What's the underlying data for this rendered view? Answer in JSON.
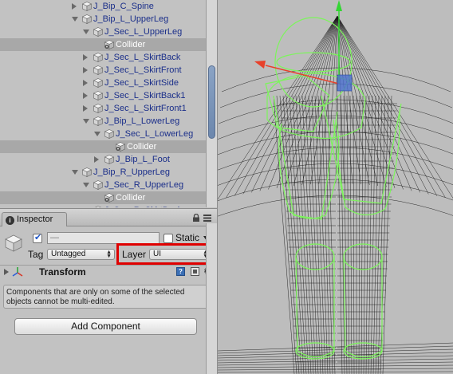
{
  "hierarchy": {
    "items": [
      {
        "label": "J_Bip_C_Spine",
        "depth": 0,
        "expanded": false,
        "kind": "cube",
        "selected": false
      },
      {
        "label": "J_Bip_L_UpperLeg",
        "depth": 0,
        "expanded": true,
        "kind": "cube",
        "selected": false
      },
      {
        "label": "J_Sec_L_UpperLeg",
        "depth": 1,
        "expanded": true,
        "kind": "cube",
        "selected": false
      },
      {
        "label": "Collider",
        "depth": 2,
        "expanded": null,
        "kind": "collider",
        "selected": true
      },
      {
        "label": "J_Sec_L_SkirtBack",
        "depth": 1,
        "expanded": false,
        "kind": "cube",
        "selected": false
      },
      {
        "label": "J_Sec_L_SkirtFront",
        "depth": 1,
        "expanded": false,
        "kind": "cube",
        "selected": false
      },
      {
        "label": "J_Sec_L_SkirtSide",
        "depth": 1,
        "expanded": false,
        "kind": "cube",
        "selected": false
      },
      {
        "label": "J_Sec_L_SkirtBack1",
        "depth": 1,
        "expanded": false,
        "kind": "cube",
        "selected": false
      },
      {
        "label": "J_Sec_L_SkirtFront1",
        "depth": 1,
        "expanded": false,
        "kind": "cube",
        "selected": false
      },
      {
        "label": "J_Bip_L_LowerLeg",
        "depth": 1,
        "expanded": true,
        "kind": "cube",
        "selected": false
      },
      {
        "label": "J_Sec_L_LowerLeg",
        "depth": 2,
        "expanded": true,
        "kind": "cube",
        "selected": false
      },
      {
        "label": "Collider",
        "depth": 3,
        "expanded": null,
        "kind": "collider",
        "selected": true
      },
      {
        "label": "J_Bip_L_Foot",
        "depth": 2,
        "expanded": false,
        "kind": "cube",
        "selected": false
      },
      {
        "label": "J_Bip_R_UpperLeg",
        "depth": 0,
        "expanded": true,
        "kind": "cube",
        "selected": false
      },
      {
        "label": "J_Sec_R_UpperLeg",
        "depth": 1,
        "expanded": true,
        "kind": "cube",
        "selected": false
      },
      {
        "label": "Collider",
        "depth": 2,
        "expanded": null,
        "kind": "collider",
        "selected": true
      },
      {
        "label": "J_Sec_R_SkirtBack",
        "depth": 1,
        "expanded": false,
        "kind": "cube",
        "selected": false
      }
    ]
  },
  "inspector": {
    "tab_label": "Inspector",
    "lock_icon": "lock-icon",
    "menu_icon": "menu-icon",
    "object": {
      "name_value": "—",
      "active": true,
      "static_label": "Static",
      "static_checked": false,
      "tag_label": "Tag",
      "tag_value": "Untagged",
      "layer_label": "Layer",
      "layer_value": "UI"
    },
    "transform": {
      "label": "Transform",
      "help_glyph": "?",
      "gear_glyph": "⚙"
    },
    "help_message": "Components that are only on some of the selected objects cannot be multi-edited.",
    "add_component_label": "Add Component"
  },
  "colors": {
    "highlight_box": "#e00000",
    "hierarchy_text": "#1b2f8a",
    "collider_wire": "#7cf55b",
    "mesh_wire": "#1a1a1a",
    "gizmo_y": "#33d633",
    "gizmo_x": "#e8402a",
    "gizmo_center": "#4a6fd0"
  }
}
